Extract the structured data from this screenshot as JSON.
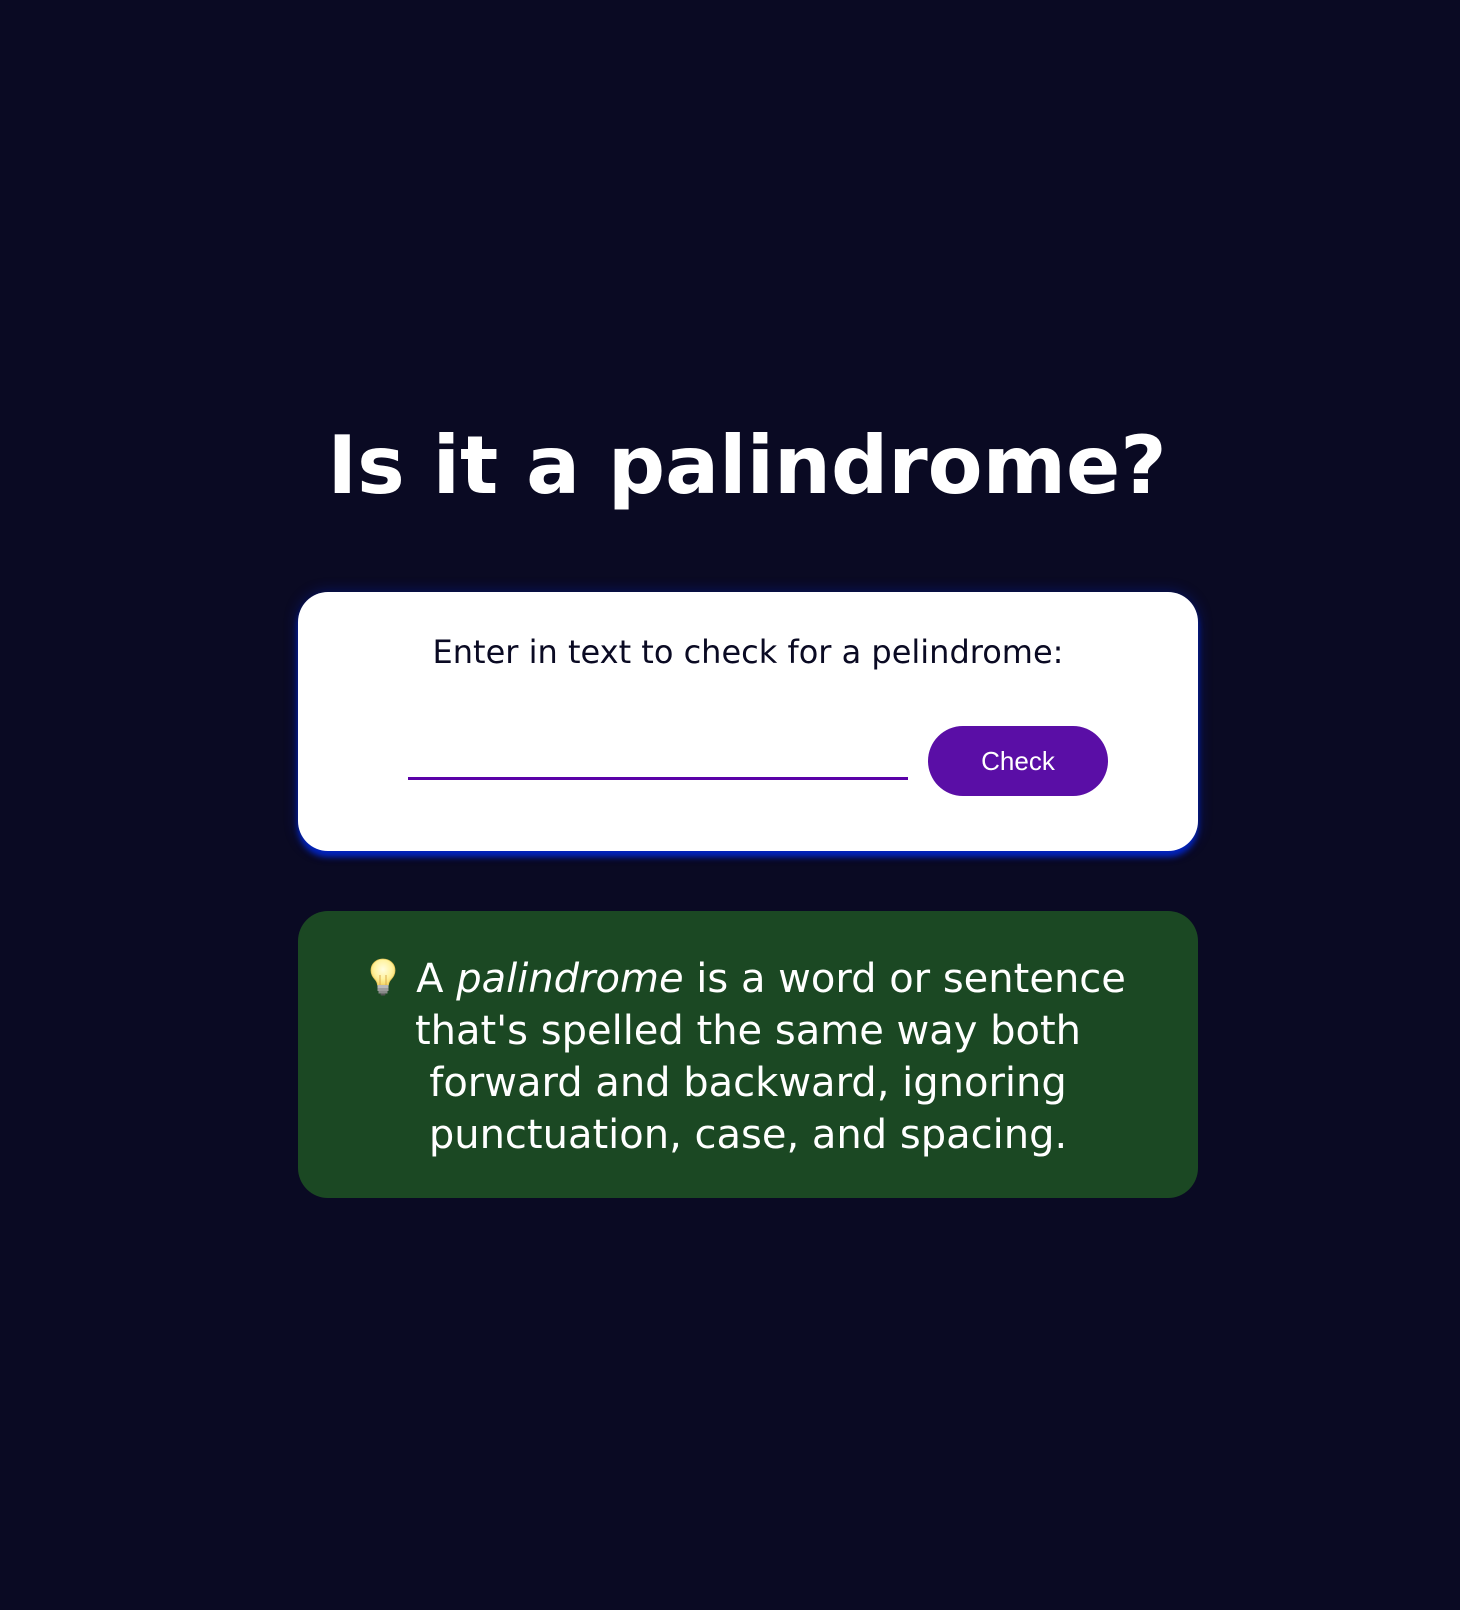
{
  "page": {
    "title": "Is it a palindrome?"
  },
  "input_card": {
    "label": "Enter in text to check for a pelindrome:",
    "input_value": "",
    "input_placeholder": "",
    "check_button_label": "Check"
  },
  "info_card": {
    "icon": "lightbulb-icon",
    "prefix": "A",
    "term": "palindrome",
    "definition": "is a word or sentence that's spelled the same way both forward and backward, ignoring punctuation, case, and spacing."
  },
  "colors": {
    "background": "#0a0a23",
    "card_background": "#ffffff",
    "accent": "#5a01a7",
    "info_background": "#1b4823",
    "text_light": "#ffffff"
  }
}
